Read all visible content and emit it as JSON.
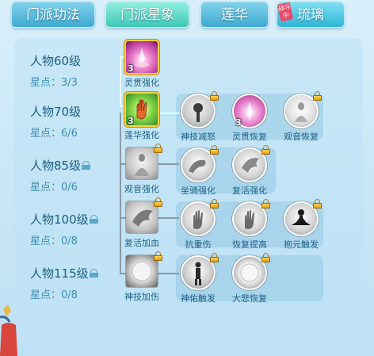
{
  "tabs": [
    {
      "label": "门派功法",
      "state": "inactive"
    },
    {
      "label": "门派星象",
      "state": "active"
    },
    {
      "label": "莲华",
      "state": "inactive"
    },
    {
      "label": "琉璃",
      "state": "inactive",
      "badge": "战斗中"
    }
  ],
  "levels": [
    {
      "title": "人物60级",
      "stars": "星点：3/3",
      "locked": false
    },
    {
      "title": "人物70级",
      "stars": "星点：6/6",
      "locked": false
    },
    {
      "title": "人物85级",
      "stars": "星点：0/6",
      "locked": true
    },
    {
      "title": "人物100级",
      "stars": "星点：0/8",
      "locked": true
    },
    {
      "title": "人物115级",
      "stars": "星点：0/8",
      "locked": true
    }
  ],
  "skills": {
    "r1": [
      {
        "label": "灵贯强化",
        "count": "3",
        "shape": "square",
        "locked": false,
        "icon": "lotus-pink-icon"
      }
    ],
    "r2": [
      {
        "label": "莲华强化",
        "count": "3",
        "shape": "square",
        "locked": false,
        "icon": "green-hand-icon"
      },
      {
        "label": "神技减怒",
        "count": "",
        "shape": "circle",
        "locked": true,
        "icon": "gourd-icon"
      },
      {
        "label": "灵贯恢复",
        "count": "3",
        "shape": "circle",
        "locked": false,
        "icon": "lotus-pink-icon"
      },
      {
        "label": "观音恢复",
        "count": "",
        "shape": "circle",
        "locked": true,
        "icon": "guanyin-icon"
      }
    ],
    "r3": [
      {
        "label": "观音强化",
        "count": "",
        "shape": "square",
        "locked": true,
        "icon": "guanyin-icon"
      },
      {
        "label": "坐骑强化",
        "count": "",
        "shape": "circle",
        "locked": true,
        "icon": "mount-icon"
      },
      {
        "label": "复活强化",
        "count": "",
        "shape": "circle",
        "locked": true,
        "icon": "wing-hand-icon"
      }
    ],
    "r4": [
      {
        "label": "复活加血",
        "count": "",
        "shape": "square",
        "locked": true,
        "icon": "wing-hand-icon"
      },
      {
        "label": "抗重伤",
        "count": "",
        "shape": "circle",
        "locked": true,
        "icon": "palm-icon"
      },
      {
        "label": "恢复提高",
        "count": "",
        "shape": "circle",
        "locked": true,
        "icon": "palm-icon"
      },
      {
        "label": "抱元触发",
        "count": "",
        "shape": "circle",
        "locked": true,
        "icon": "meditate-icon"
      }
    ],
    "r5": [
      {
        "label": "神技加伤",
        "count": "",
        "shape": "square",
        "locked": true,
        "icon": "pearl-icon"
      },
      {
        "label": "神佑触发",
        "count": "",
        "shape": "circle",
        "locked": true,
        "icon": "figure-icon"
      },
      {
        "label": "大悲恢复",
        "count": "",
        "shape": "circle",
        "locked": true,
        "icon": "pearl-icon"
      }
    ]
  }
}
